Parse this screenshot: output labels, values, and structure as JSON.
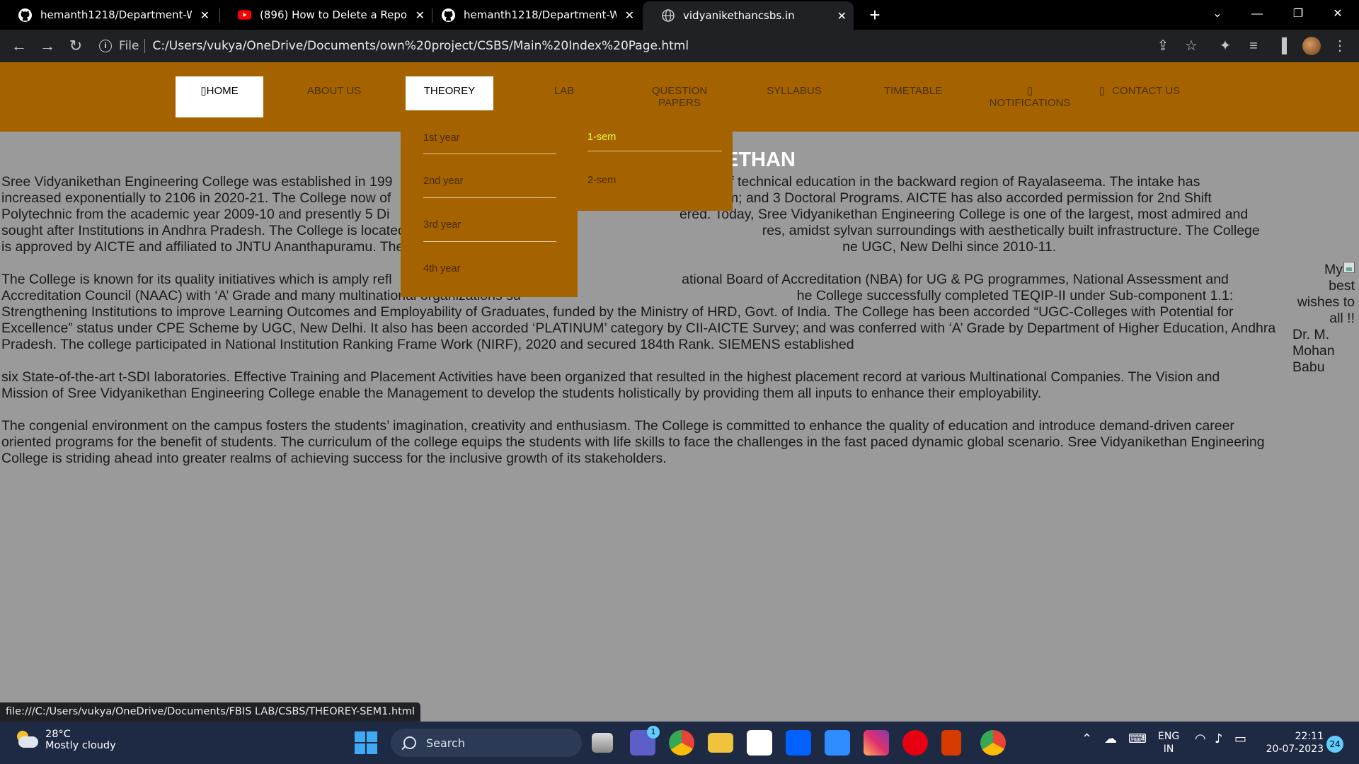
{
  "browser": {
    "tabs": [
      {
        "title": "hemanth1218/Department-Webs",
        "icon": "github-icon"
      },
      {
        "title": "(896) How to Delete a Repository",
        "icon": "youtube-icon"
      },
      {
        "title": "hemanth1218/Department-Webs",
        "icon": "github-icon"
      },
      {
        "title": "vidyanikethancsbs.in",
        "icon": "globe-icon"
      }
    ],
    "active_tab_index": 3,
    "close_glyph": "✕",
    "new_tab_glyph": "+",
    "address": {
      "scheme_label": "File",
      "url": "C:/Users/vukya/OneDrive/Documents/own%20project/CSBS/Main%20Index%20Page.html"
    },
    "status_url": "file:///C:/Users/vukya/OneDrive/Documents/FBIS LAB/CSBS/THEOREY-SEM1.html"
  },
  "site": {
    "nav": {
      "home": "HOME",
      "about": "ABOUT US",
      "theorey": "THEOREY",
      "lab": "LAB",
      "question_papers": "QUESTION PAPERS",
      "syllabus": "SYLLABUS",
      "timetable": "TIMETABLE",
      "notifications": "NOTIFICATIONS",
      "contact": "CONTACT US"
    },
    "dropdown": {
      "years": [
        "1st year",
        "2nd year",
        "3rd year",
        "4th year"
      ],
      "sems": [
        "1-sem",
        "2-sem"
      ]
    },
    "heading_visible": "ETHAN",
    "paragraphs": [
      "Sree Vidyanikethan Engineering College was established in 199                      use of technical education in the backward region of Rayalaseema. The intake has increased exponentially to 2106 in 2020-21. The College now of                      rogram; and 3 Doctoral Programs. AICTE has also accorded permission for 2nd Shift Polytechnic from the academic year 2009-10 and presently 5 Di                     ered. Today, Sree Vidyanikethan Engineering College is one of the largest, most admired and sought after Institutions in Andhra Pradesh. The College is located in a spraw                     res, amidst sylvan surroundings with aesthetically built infrastructure. The College is approved by AICTE and affiliated to JNTU Ananthapuramu. The College has been accor                     ne UGC, New Delhi since 2010-11.",
      "The College is known for its quality initiatives which is amply refl                     ational Board of Accreditation (NBA) for UG & PG programmes, National Assessment and Accreditation Council (NAAC) with ‘A’ Grade and many multinational organizations su                    he College successfully completed TEQIP-II under Sub-component 1.1: Strengthening Institutions to improve Learning Outcomes and Employability of Graduates, funded by the Ministry of HRD, Govt. of India. The College has been accorded “UGC-Colleges with Potential for Excellence” status under CPE Scheme by UGC, New Delhi. It also has been accorded ‘PLATINUM’ category by CII-AICTE Survey; and was conferred with ‘A’ Grade by Department of Higher Education, Andhra Pradesh. The college participated in National Institution Ranking Frame Work (NIRF), 2020 and secured 184th Rank. SIEMENS established",
      "six State-of-the-art t-SDI laboratories. Effective Training and Placement Activities have been organized that resulted in the highest placement record at various Multinational Companies. The Vision and Mission of Sree Vidyanikethan Engineering College enable the Management to develop the students holistically by providing them all inputs to enhance their employability.",
      "The congenial environment on the campus fosters the students’ imagination, creativity and enthusiasm. The College is committed to enhance the quality of education and introduce demand-driven career oriented programs for the benefit of students. The curriculum of the college equips the students with life skills to face the challenges in the fast paced dynamic global scenario. Sree Vidyanikethan Engineering College is striding ahead into greater realms of achieving success for the inclusive growth of its stakeholders."
    ],
    "sidenote": {
      "l1": "My",
      "l2": "best",
      "l3": "wishes to",
      "l4": "all !!",
      "l5": "Dr. M.",
      "l6": "Mohan",
      "l7": "Babu"
    }
  },
  "taskbar": {
    "weather_temp": "28°C",
    "weather_desc": "Mostly cloudy",
    "search_label": "Search",
    "teams_badge": "1",
    "lang_top": "ENG",
    "lang_bottom": "IN",
    "time": "22:11",
    "date": "20-07-2023",
    "notif_count": "24"
  },
  "colors": {
    "nav_bg": "#a56300",
    "page_bg": "#9a9a9a",
    "highlight": "#f2ff3a"
  }
}
